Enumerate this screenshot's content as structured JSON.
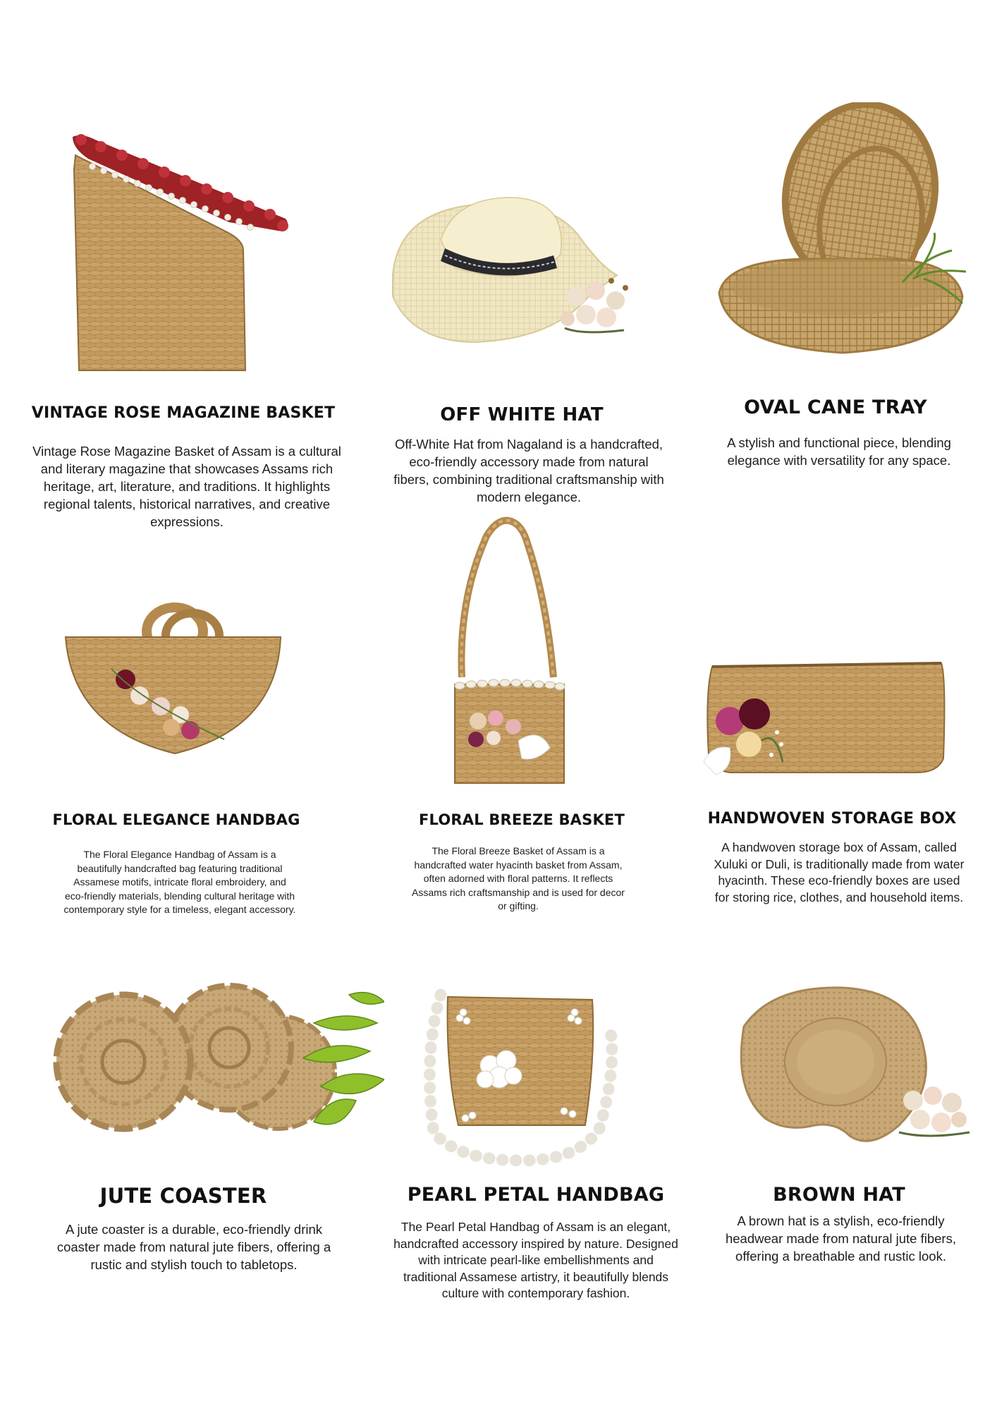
{
  "products": [
    {
      "title": "VINTAGE ROSE MAGAZINE BASKET",
      "description": "Vintage Rose Magazine Basket of Assam is a cultural and literary magazine that showcases Assams rich heritage, art, literature, and traditions. It highlights regional talents, historical narratives, and creative expressions."
    },
    {
      "title": "OFF WHITE  HAT",
      "description": "Off-White Hat from Nagaland is a handcrafted, eco-friendly accessory made from natural fibers, combining traditional craftsmanship with modern elegance."
    },
    {
      "title": "OVAL CANE TRAY",
      "description": "A stylish and functional piece, blending elegance with versatility for any space."
    },
    {
      "title": "FLORAL ELEGANCE HANDBAG",
      "description": "The Floral Elegance Handbag of Assam is a beautifully handcrafted bag featuring traditional Assamese motifs, intricate floral embroidery, and eco-friendly materials, blending cultural heritage with contemporary style for a timeless, elegant accessory."
    },
    {
      "title": "FLORAL BREEZE BASKET",
      "description": "The Floral Breeze Basket of Assam is a handcrafted water hyacinth basket from Assam, often adorned with floral patterns. It reflects Assams rich craftsmanship and is used for decor or gifting."
    },
    {
      "title": "HANDWOVEN STORAGE BOX",
      "description": "A handwoven storage box of Assam, called Xuluki or Duli, is traditionally made from water hyacinth. These eco-friendly boxes are used for storing rice, clothes, and household items."
    },
    {
      "title": "JUTE COASTER",
      "description": "A jute coaster is a durable, eco-friendly drink coaster made from natural jute fibers, offering a rustic and stylish touch to tabletops."
    },
    {
      "title": "PEARL PETAL HANDBAG",
      "description": "The Pearl Petal Handbag of Assam is an elegant, handcrafted accessory inspired by nature. Designed with intricate pearl-like embellishments and traditional Assamese artistry, it beautifully blends culture with contemporary fashion."
    },
    {
      "title": "BROWN HAT",
      "description": "A brown hat is a stylish, eco-friendly headwear made from natural jute fibers, offering a breathable and rustic look."
    }
  ]
}
